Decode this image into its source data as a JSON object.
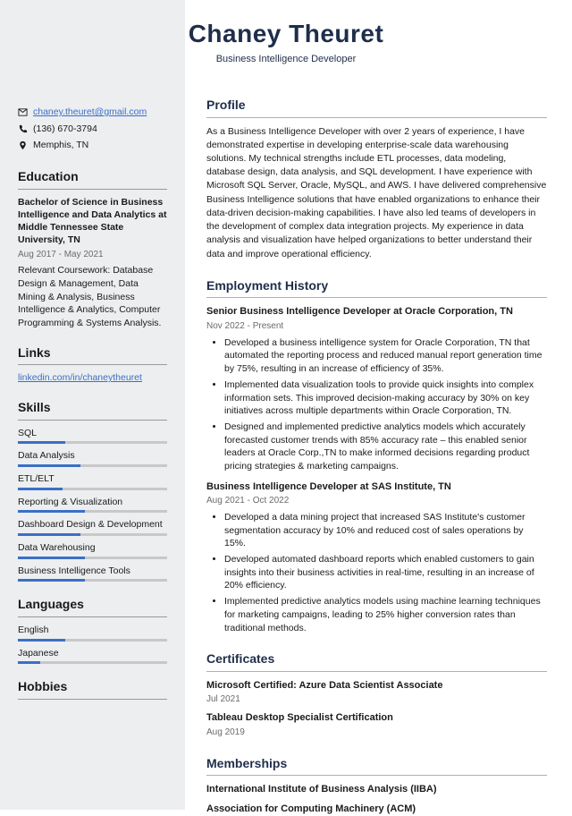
{
  "header": {
    "name": "Chaney Theuret",
    "title": "Business Intelligence Developer"
  },
  "contact": {
    "email": "chaney.theuret@gmail.com",
    "phone": "(136) 670-3794",
    "location": "Memphis, TN"
  },
  "education": {
    "heading": "Education",
    "degree": "Bachelor of Science in Business Intelligence and Data Analytics at Middle Tennessee State University, TN",
    "dates": "Aug 2017 - May 2021",
    "body": "Relevant Coursework: Database Design & Management, Data Mining & Analysis, Business Intelligence & Analytics, Computer Programming & Systems Analysis."
  },
  "links": {
    "heading": "Links",
    "item": "linkedin.com/in/chaneytheuret"
  },
  "skills": {
    "heading": "Skills",
    "items": [
      {
        "name": "SQL",
        "pct": 32
      },
      {
        "name": "Data Analysis",
        "pct": 42
      },
      {
        "name": "ETL/ELT",
        "pct": 30
      },
      {
        "name": "Reporting & Visualization",
        "pct": 45
      },
      {
        "name": "Dashboard Design & Development",
        "pct": 42
      },
      {
        "name": "Data Warehousing",
        "pct": 45
      },
      {
        "name": "Business Intelligence Tools",
        "pct": 45
      }
    ]
  },
  "languages": {
    "heading": "Languages",
    "items": [
      {
        "name": "English",
        "pct": 32
      },
      {
        "name": "Japanese",
        "pct": 15
      }
    ]
  },
  "hobbies": {
    "heading": "Hobbies"
  },
  "profile": {
    "heading": "Profile",
    "body": "As a Business Intelligence Developer with over 2 years of experience, I have demonstrated expertise in developing enterprise-scale data warehousing solutions. My technical strengths include ETL processes, data modeling, database design, data analysis, and SQL development. I have experience with Microsoft SQL Server, Oracle, MySQL, and AWS. I have delivered comprehensive Business Intelligence solutions that have enabled organizations to enhance their data-driven decision-making capabilities. I have also led teams of developers in the development of complex data integration projects. My experience in data analysis and visualization have helped organizations to better understand their data and improve operational efficiency."
  },
  "employment": {
    "heading": "Employment History",
    "jobs": [
      {
        "title": "Senior Business Intelligence Developer at Oracle Corporation, TN",
        "dates": "Nov 2022 - Present",
        "bullets": [
          "Developed a business intelligence system for Oracle Corporation, TN that automated the reporting process and reduced manual report generation time by 75%, resulting in an increase of efficiency of 35%.",
          "Implemented data visualization tools to provide quick insights into complex information sets. This improved decision-making accuracy by 30% on key initiatives across multiple departments within Oracle Corporation, TN.",
          "Designed and implemented predictive analytics models which accurately forecasted customer trends with 85% accuracy rate – this enabled senior leaders at Oracle Corp.,TN to make informed decisions regarding product pricing strategies & marketing campaigns."
        ]
      },
      {
        "title": "Business Intelligence Developer at SAS Institute, TN",
        "dates": "Aug 2021 - Oct 2022",
        "bullets": [
          "Developed a data mining project that increased SAS Institute's customer segmentation accuracy by 10% and reduced cost of sales operations by 15%.",
          "Developed automated dashboard reports which enabled customers to gain insights into their business activities in real-time, resulting in an increase of 20% efficiency.",
          "Implemented predictive analytics models using machine learning techniques for marketing campaigns, leading to 25% higher conversion rates than traditional methods."
        ]
      }
    ]
  },
  "certificates": {
    "heading": "Certificates",
    "items": [
      {
        "title": "Microsoft Certified: Azure Data Scientist Associate",
        "date": "Jul 2021"
      },
      {
        "title": "Tableau Desktop Specialist Certification",
        "date": "Aug 2019"
      }
    ]
  },
  "memberships": {
    "heading": "Memberships",
    "items": [
      "International Institute of Business Analysis (IIBA)",
      "Association for Computing Machinery (ACM)"
    ]
  }
}
